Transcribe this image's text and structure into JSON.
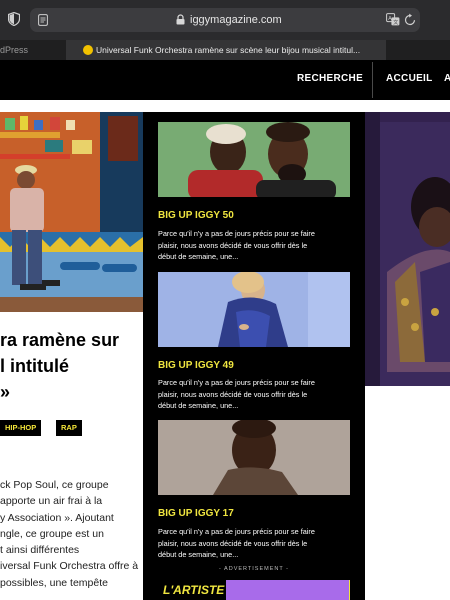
{
  "browser": {
    "url": "iggymagazine.com",
    "tab_inactive_label": "dPress",
    "tab_active_label": "Universal Funk Orchestra ramène sur scène leur bijou musical intitul..."
  },
  "nav": {
    "search": "RECHERCHE",
    "home": "ACCUEIL",
    "partial": "A"
  },
  "article": {
    "headline_lines": [
      "ra ramène sur",
      "l intitulé",
      "»"
    ],
    "tags": [
      "HIP-HOP",
      "RAP"
    ],
    "body_lines": [
      "ck Pop Soul, ce groupe",
      "apporte un air frai à la",
      "y Association ». Ajoutant",
      "ngle, ce groupe est un",
      "t ainsi différentes",
      "iversal Funk Orchestra offre à",
      "possibles, une tempête"
    ]
  },
  "cards": [
    {
      "title": "BIG UP IGGY 50",
      "excerpt_lines": [
        "Parce qu'il n'y a pas de jours précis pour se faire",
        "plaisir, nous avons décidé de vous offrir dès le",
        "début de semaine, une..."
      ]
    },
    {
      "title": "BIG UP IGGY 49",
      "excerpt_lines": [
        "Parce qu'il n'y a pas de jours précis pour se faire",
        "plaisir, nous avons décidé de vous offrir dès le",
        "début de semaine, une..."
      ]
    },
    {
      "title": "BIG UP IGGY 17",
      "excerpt_lines": [
        "Parce qu'il n'y a pas de jours précis pour se faire",
        "plaisir, nous avons décidé de vous offrir dès le",
        "début de semaine, une..."
      ]
    }
  ],
  "ad": {
    "label": "- ADVERTISEMENT -",
    "banner_text": "L'ARTISTE"
  },
  "colors": {
    "accent_yellow": "#f0e640",
    "nav_bg": "#000000",
    "ad_purple": "#a86bea"
  },
  "icons": [
    "shield-icon",
    "reader-icon",
    "lock-icon",
    "translate-icon",
    "reload-icon"
  ]
}
